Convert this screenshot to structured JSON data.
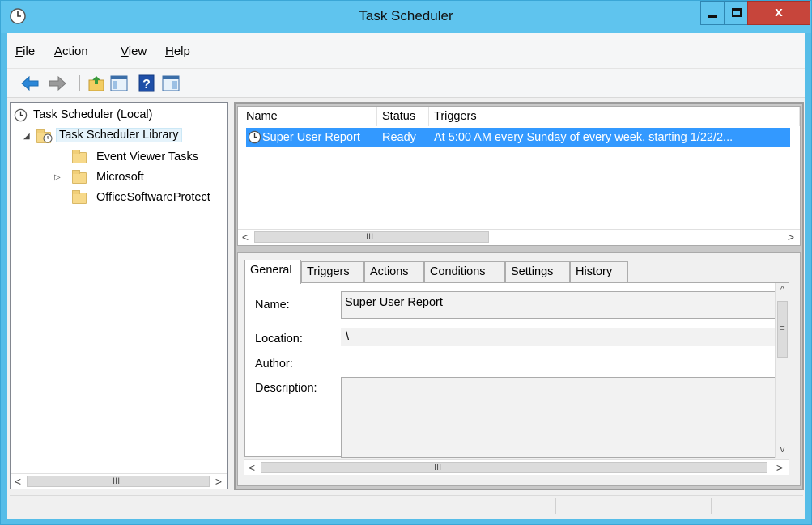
{
  "window": {
    "title": "Task Scheduler",
    "close_glyph": "x",
    "colors": {
      "titlebar": "#5fc4ee",
      "close": "#c7453b",
      "selection": "#3399ff"
    }
  },
  "menu": {
    "file": {
      "u": "F",
      "rest": "ile"
    },
    "action": {
      "u": "A",
      "rest": "ction"
    },
    "view": {
      "u": "V",
      "rest": "iew"
    },
    "help": {
      "u": "H",
      "rest": "elp"
    }
  },
  "toolbar": {
    "icons": [
      "back-arrow-icon",
      "forward-arrow-icon",
      "folder-up-icon",
      "show-hide-console-tree-icon",
      "help-icon",
      "show-hide-action-pane-icon"
    ]
  },
  "tree": {
    "root": "Task Scheduler (Local)",
    "library": "Task Scheduler Library",
    "items": [
      "Event Viewer Tasks",
      "Microsoft",
      "OfficeSoftwareProtect"
    ]
  },
  "tasklist": {
    "columns": [
      "Name",
      "Status",
      "Triggers"
    ],
    "rows": [
      {
        "name": "Super User Report",
        "status": "Ready",
        "triggers": "At 5:00 AM every Sunday of every week, starting 1/22/2..."
      }
    ]
  },
  "details": {
    "tabs": [
      "General",
      "Triggers",
      "Actions",
      "Conditions",
      "Settings",
      "History"
    ],
    "active_tab": "General",
    "labels": {
      "name": "Name:",
      "location": "Location:",
      "author": "Author:",
      "description": "Description:"
    },
    "values": {
      "name": "Super User Report",
      "location": "\\",
      "author": "",
      "description": ""
    }
  },
  "scroll": {
    "left": "<",
    "right": ">",
    "up": "^",
    "down": "v",
    "grip": "III",
    "vgrip": "≡"
  }
}
